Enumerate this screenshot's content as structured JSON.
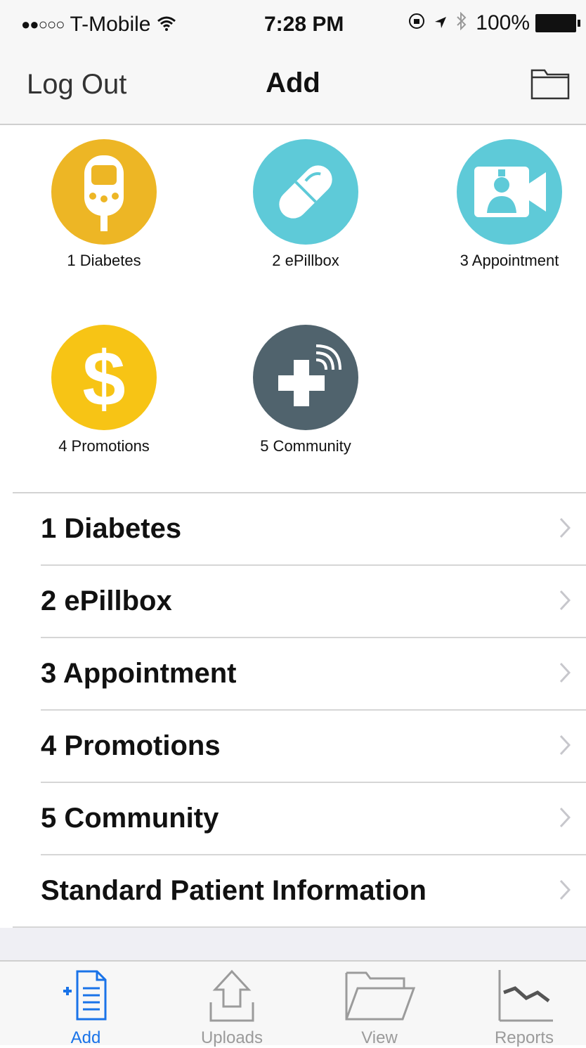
{
  "status_bar": {
    "signal": "●●○○○",
    "carrier": "T-Mobile",
    "wifi_icon": "wifi-icon",
    "time": "7:28 PM",
    "rotation_lock_icon": "rotation-lock-icon",
    "location_icon": "location-arrow-icon",
    "bluetooth_icon": "bluetooth-icon",
    "battery_percent": "100%"
  },
  "nav": {
    "left_button": "Log Out",
    "title": "Add",
    "right_icon": "folder-icon"
  },
  "grid": {
    "tiles": [
      {
        "label": "1 Diabetes",
        "color": "#EDB625",
        "icon": "glucose-meter-icon"
      },
      {
        "label": "2 ePillbox",
        "color": "#5ECAD8",
        "icon": "pill-capsule-icon"
      },
      {
        "label": "3 Appointment",
        "color": "#5ECAD8",
        "icon": "video-doctor-icon"
      },
      {
        "label": "4 Promotions",
        "color": "#F7C415",
        "icon": "dollar-sign-icon"
      },
      {
        "label": "5 Community",
        "color": "#50636D",
        "icon": "medical-cross-broadcast-icon"
      }
    ]
  },
  "list": {
    "items": [
      {
        "label": "1 Diabetes"
      },
      {
        "label": "2 ePillbox"
      },
      {
        "label": "3 Appointment"
      },
      {
        "label": "4 Promotions"
      },
      {
        "label": "5 Community"
      },
      {
        "label": "Standard Patient Information"
      }
    ]
  },
  "tab_bar": {
    "active_color": "#1A73E8",
    "inactive_color": "#9B9B9B",
    "tabs": [
      {
        "label": "Add",
        "icon": "add-document-icon",
        "active": true
      },
      {
        "label": "Uploads",
        "icon": "upload-icon",
        "active": false
      },
      {
        "label": "View",
        "icon": "open-folder-icon",
        "active": false
      },
      {
        "label": "Reports",
        "icon": "line-chart-icon",
        "active": false
      }
    ]
  }
}
